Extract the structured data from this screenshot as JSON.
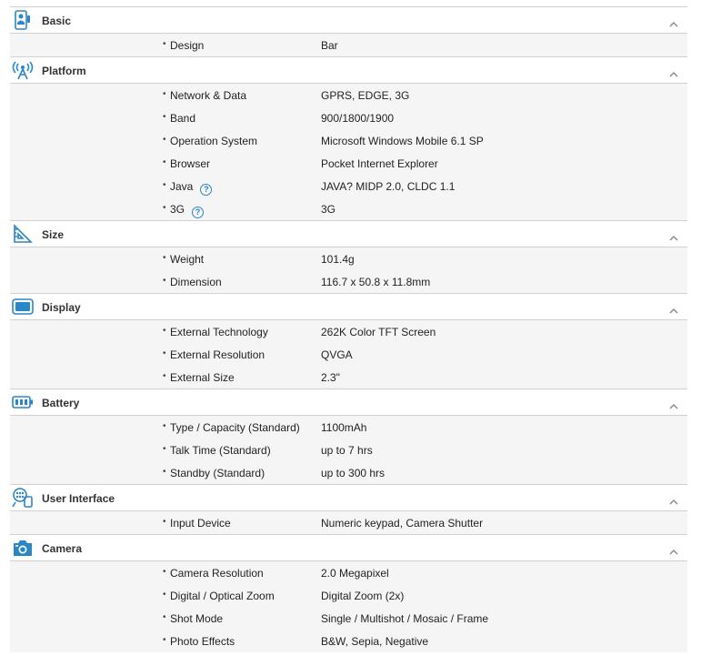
{
  "colors": {
    "accent": "#2a86c7",
    "row_bg": "#f5f5f5",
    "divider": "#d0d0d0"
  },
  "sections": [
    {
      "title": "Basic",
      "icon": "phone-person-icon",
      "rows": [
        {
          "label": "Design",
          "value": "Bar"
        }
      ]
    },
    {
      "title": "Platform",
      "icon": "antenna-icon",
      "rows": [
        {
          "label": "Network & Data",
          "value": "GPRS, EDGE, 3G"
        },
        {
          "label": "Band",
          "value": "900/1800/1900"
        },
        {
          "label": "Operation System",
          "value": "Microsoft Windows Mobile 6.1 SP"
        },
        {
          "label": "Browser",
          "value": "Pocket Internet Explorer"
        },
        {
          "label": "Java",
          "value": "JAVA? MIDP 2.0, CLDC 1.1",
          "help": "?"
        },
        {
          "label": "3G",
          "value": "3G",
          "help": "?"
        }
      ]
    },
    {
      "title": "Size",
      "icon": "ruler-triangle-icon",
      "rows": [
        {
          "label": "Weight",
          "value": "101.4g"
        },
        {
          "label": "Dimension",
          "value": "116.7 x 50.8 x 11.8mm"
        }
      ]
    },
    {
      "title": "Display",
      "icon": "screen-icon",
      "rows": [
        {
          "label": "External Technology",
          "value": "262K Color TFT Screen"
        },
        {
          "label": "External Resolution",
          "value": "QVGA"
        },
        {
          "label": "External Size",
          "value": "2.3\""
        }
      ]
    },
    {
      "title": "Battery",
      "icon": "battery-icon",
      "rows": [
        {
          "label": "Type / Capacity (Standard)",
          "value": "1100mAh"
        },
        {
          "label": "Talk Time (Standard)",
          "value": "up to 7 hrs"
        },
        {
          "label": "Standby (Standard)",
          "value": "up to 300 hrs"
        }
      ]
    },
    {
      "title": "User Interface",
      "icon": "touch-interface-icon",
      "rows": [
        {
          "label": "Input Device",
          "value": "Numeric keypad, Camera Shutter"
        }
      ]
    },
    {
      "title": "Camera",
      "icon": "camera-icon",
      "rows": [
        {
          "label": "Camera Resolution",
          "value": "2.0 Megapixel"
        },
        {
          "label": "Digital / Optical Zoom",
          "value": "Digital Zoom (2x)"
        },
        {
          "label": "Shot Mode",
          "value": "Single / Multishot / Mosaic / Frame"
        },
        {
          "label": "Photo Effects",
          "value": "B&W, Sepia, Negative"
        }
      ]
    }
  ]
}
